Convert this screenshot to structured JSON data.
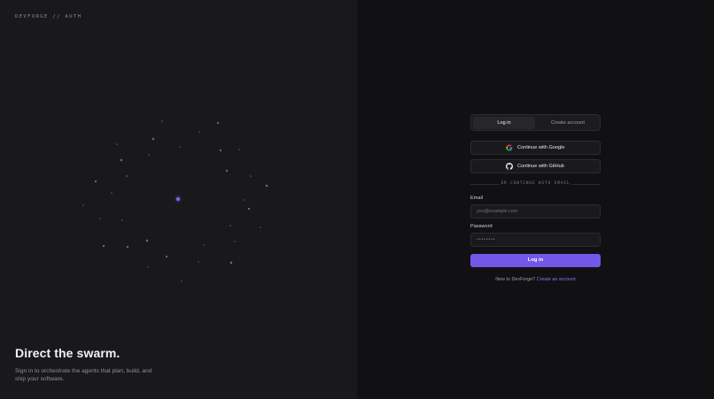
{
  "brand": {
    "text": "DEVFORGE // AUTH"
  },
  "hero": {
    "title": "Direct the swarm.",
    "subtitle": "Sign in to orchestrate the agents that plan, build, and ship your software."
  },
  "colors": {
    "accent": "#7357e9",
    "link": "#8b73ff",
    "left_panel": "#19191c",
    "right_panel": "#111113"
  },
  "tabs": {
    "login_label": "Log in",
    "create_label": "Create account",
    "active": "Log in"
  },
  "oauth": {
    "google_label": "Continue with Google",
    "google_icon": "google-logo-icon",
    "github_label": "Continue with GitHub",
    "github_icon": "github-logo-icon"
  },
  "divider": {
    "text": "OR CONTINUE WITH EMAIL"
  },
  "form": {
    "email_label": "Email",
    "email_placeholder": "you@example.com",
    "password_label": "Password",
    "password_placeholder": "••••••••",
    "submit_label": "Log in"
  },
  "footer": {
    "prompt": "New to DevForge?",
    "link_text": "Create an account"
  }
}
